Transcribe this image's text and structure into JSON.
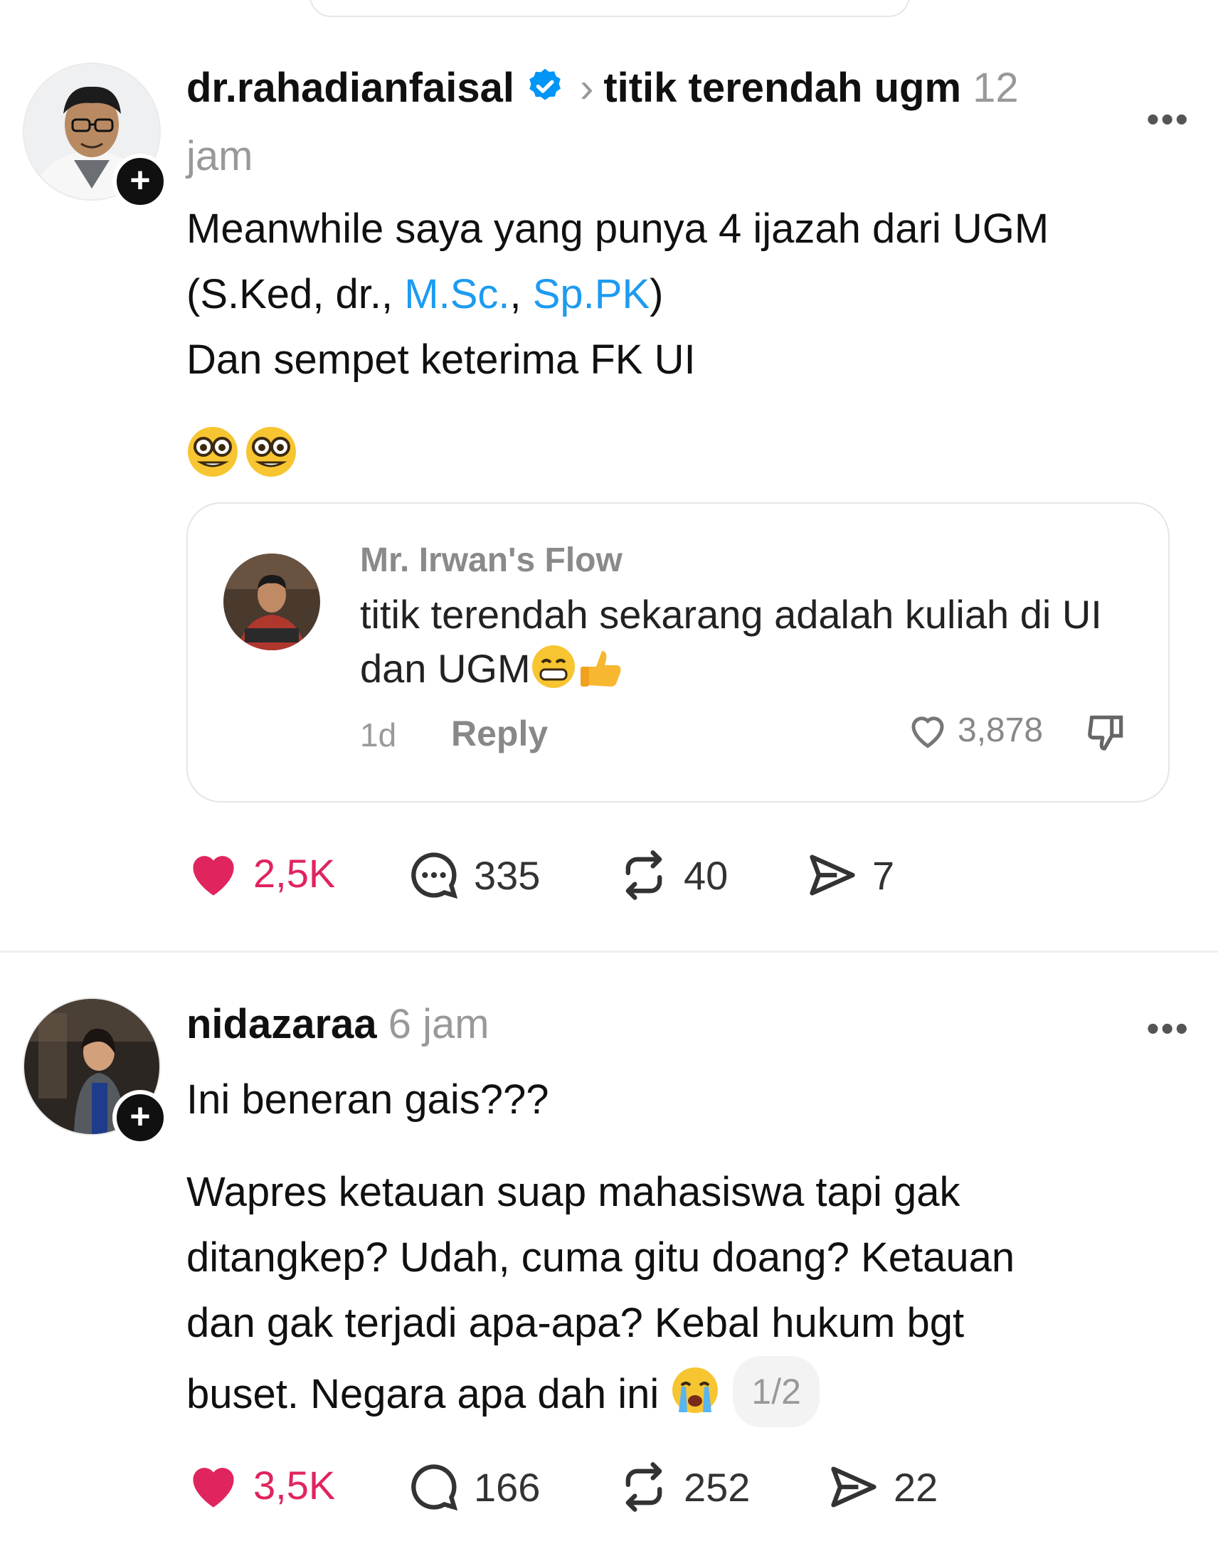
{
  "post1": {
    "username": "dr.rahadianfaisal",
    "topic": "titik terendah ugm",
    "time_number": "12",
    "time_unit": "jam",
    "line1": "Meanwhile saya yang punya 4 ijazah dari UGM",
    "line2_part1": "(S.Ked, dr., ",
    "line2_link1": "M.Sc.",
    "line2_sep": ", ",
    "line2_link2": "Sp.PK",
    "line2_part2": ")",
    "line3": "Dan sempet keterima FK UI",
    "quote": {
      "name": "Mr. Irwan's Flow",
      "text": "titik terendah sekarang adalah kuliah di UI dan UGM",
      "time": "1d",
      "reply_label": "Reply",
      "likes": "3,878"
    },
    "actions": {
      "likes": "2,5K",
      "comments": "335",
      "reposts": "40",
      "shares": "7"
    }
  },
  "post2": {
    "username": "nidazaraa",
    "time": "6 jam",
    "para1": "Ini beneran gais???",
    "para2_line1": "Wapres ketauan suap mahasiswa tapi gak",
    "para2_line2": "ditangkep? Udah, cuma gitu doang? Ketauan",
    "para2_line3": "dan gak terjadi apa-apa? Kebal hukum bgt",
    "para2_line4": "buset. Negara apa dah ini",
    "page_counter": "1/2",
    "actions": {
      "likes": "3,5K",
      "comments": "166",
      "reposts": "252",
      "shares": "22"
    }
  },
  "colors": {
    "like_red": "#e0245e",
    "link_blue": "#1d9bf0",
    "verified_blue": "#0095f6"
  },
  "icons": [
    "verified-badge-icon",
    "heart-icon",
    "comment-icon",
    "repost-icon",
    "share-icon",
    "more-icon",
    "follow-plus-icon",
    "dislike-icon"
  ]
}
